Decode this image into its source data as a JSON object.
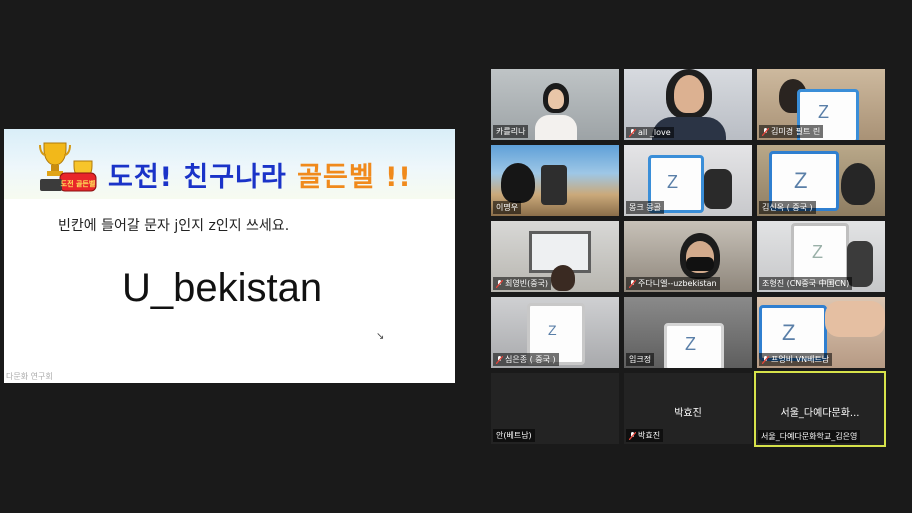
{
  "slide": {
    "title_part1": "도전! 친구나라",
    "title_part2": "골든벨 !!",
    "instruction": "빈칸에 들어갈 문자 j인지 z인지 쓰세요.",
    "word": "U_bekistan",
    "footer": "다문화 연구회",
    "trophy_label": "도전 골든벨"
  },
  "participants": [
    {
      "name": "카를리나",
      "muted": false
    },
    {
      "name": "all _love",
      "muted": true
    },
    {
      "name": "김미경 필트 린",
      "muted": true
    },
    {
      "name": "이명우",
      "muted": false
    },
    {
      "name": "몽크 몽골",
      "muted": false
    },
    {
      "name": "김신옥 ( 중국 )",
      "muted": false
    },
    {
      "name": "최영빈(중국)",
      "muted": true
    },
    {
      "name": "주다니엘--uzbekistan",
      "muted": true
    },
    {
      "name": "조형진 (CN중국 中国CN)",
      "muted": false
    },
    {
      "name": "심은종 ( 중국 )",
      "muted": true
    },
    {
      "name": "임크정",
      "muted": false
    },
    {
      "name": "프엉비 VN베트남",
      "muted": true
    },
    {
      "name": "안(베트남)",
      "muted": false,
      "center": ""
    },
    {
      "name": "박효진",
      "muted": true,
      "center": "박효진"
    },
    {
      "name": "서울_다예다문화학교_김은영",
      "muted": false,
      "center": "서울_다예다문화...",
      "active": true
    }
  ],
  "colors": {
    "background": "#1a1a1a",
    "tile": "#232323",
    "active_border": "#d6e24a",
    "muted_icon": "#e0443a"
  }
}
